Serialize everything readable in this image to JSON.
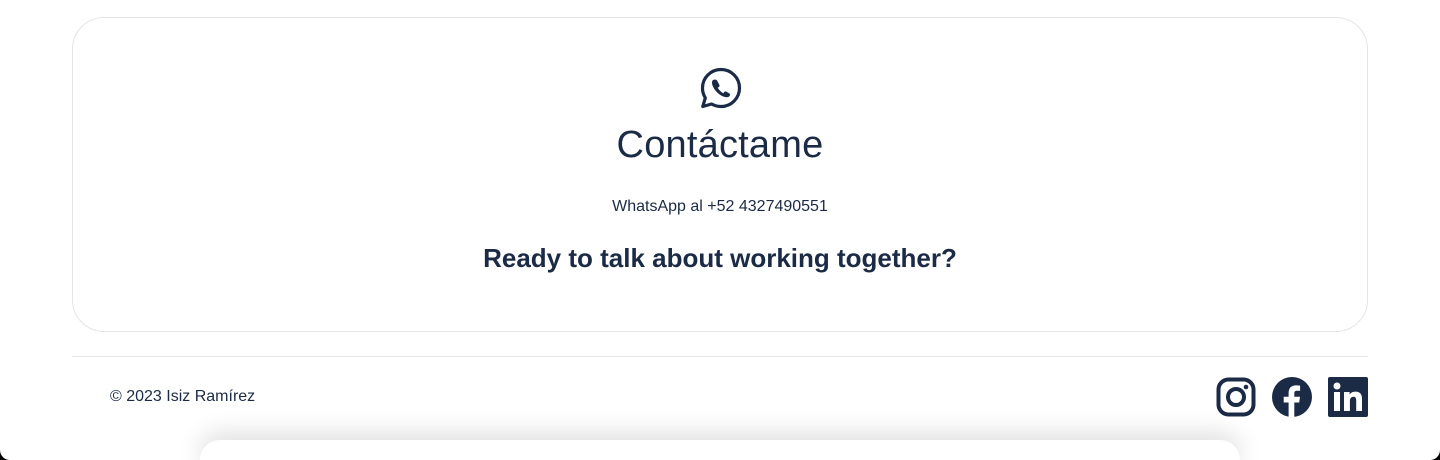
{
  "contact": {
    "icon": "whatsapp-icon",
    "title": "Contáctame",
    "phone_text": "WhatsApp al +52 4327490551",
    "cta": "Ready to talk about working together?"
  },
  "footer": {
    "copyright": "© 2023 Isiz Ramírez",
    "social": [
      {
        "name": "instagram-icon"
      },
      {
        "name": "facebook-icon"
      },
      {
        "name": "linkedin-icon"
      }
    ]
  },
  "colors": {
    "text": "#1b2a45",
    "border": "#e3e5e8",
    "background": "#ffffff"
  }
}
